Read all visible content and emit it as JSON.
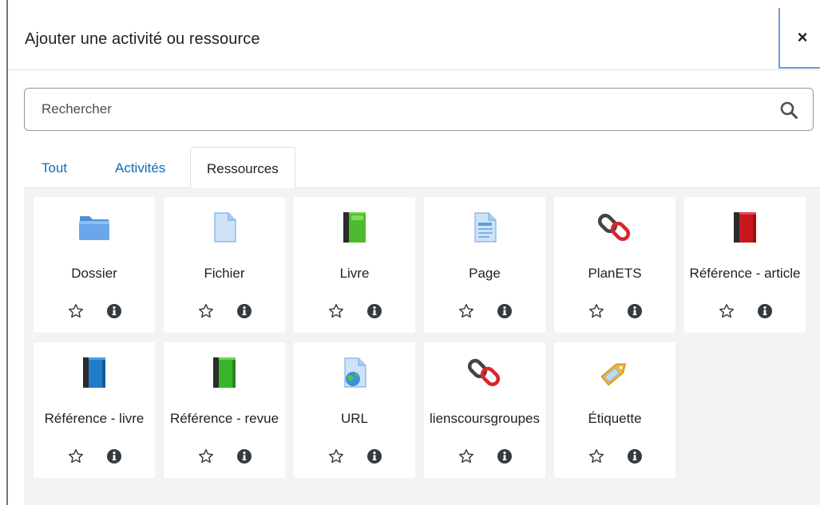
{
  "modal": {
    "title": "Ajouter une activité ou ressource",
    "close_symbol": "×"
  },
  "search": {
    "placeholder": "Rechercher",
    "value": ""
  },
  "tabs": [
    {
      "label": "Tout",
      "active": false
    },
    {
      "label": "Activités",
      "active": false
    },
    {
      "label": "Ressources",
      "active": true
    }
  ],
  "items": [
    {
      "name": "Dossier",
      "icon": "folder-icon"
    },
    {
      "name": "Fichier",
      "icon": "file-icon"
    },
    {
      "name": "Livre",
      "icon": "book-green-icon"
    },
    {
      "name": "Page",
      "icon": "page-icon"
    },
    {
      "name": "PlanETS",
      "icon": "link-icon"
    },
    {
      "name": "Référence - article",
      "icon": "book-red-icon"
    },
    {
      "name": "Référence - livre",
      "icon": "book-blue-icon"
    },
    {
      "name": "Référence - revue",
      "icon": "book-green-icon"
    },
    {
      "name": "URL",
      "icon": "url-icon"
    },
    {
      "name": "lienscoursgroupes",
      "icon": "link-icon"
    },
    {
      "name": "Étiquette",
      "icon": "label-tag-icon"
    }
  ],
  "colors": {
    "accent": "#0f6cbf",
    "grid_bg": "#f1f3f5",
    "text": "#1d2125",
    "close_border": "#6c9bd2"
  }
}
